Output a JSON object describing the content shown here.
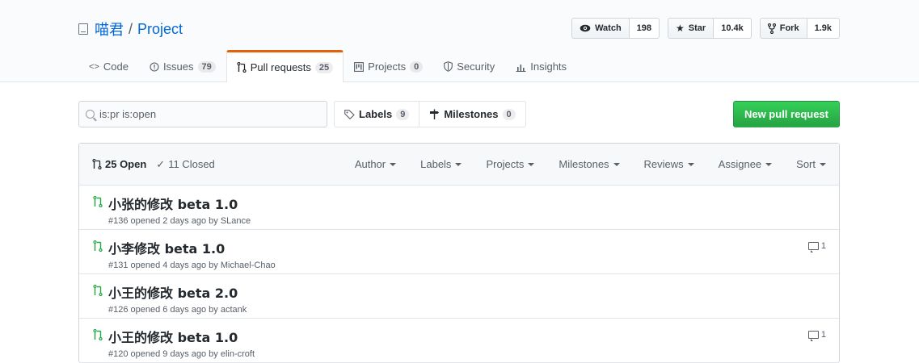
{
  "repo": {
    "owner": "喵君",
    "separator": "/",
    "name": "Project"
  },
  "actions": {
    "watch": {
      "label": "Watch",
      "count": "198"
    },
    "star": {
      "label": "Star",
      "count": "10.4k"
    },
    "fork": {
      "label": "Fork",
      "count": "1.9k"
    }
  },
  "tabs": [
    {
      "label": "Code",
      "counter": ""
    },
    {
      "label": "Issues",
      "counter": "79"
    },
    {
      "label": "Pull requests",
      "counter": "25"
    },
    {
      "label": "Projects",
      "counter": "0"
    },
    {
      "label": "Security",
      "counter": ""
    },
    {
      "label": "Insights",
      "counter": ""
    }
  ],
  "search": {
    "value": "is:pr is:open"
  },
  "subnav": {
    "labels": {
      "label": "Labels",
      "counter": "9"
    },
    "milestones": {
      "label": "Milestones",
      "counter": "0"
    }
  },
  "new_pr_label": "New pull request",
  "states": {
    "open": "25 Open",
    "closed": "11 Closed"
  },
  "filters": [
    "Author",
    "Labels",
    "Projects",
    "Milestones",
    "Reviews",
    "Assignee",
    "Sort"
  ],
  "pulls": [
    {
      "title": "小张的修改 beta 1.0",
      "meta": "#136 opened 2 days ago by SLance",
      "comments": ""
    },
    {
      "title": "小李修改 beta 1.0",
      "meta": "#131 opened 4 days ago by Michael-Chao",
      "comments": "1"
    },
    {
      "title": "小王的修改 beta 2.0",
      "meta": "#126 opened 6 days ago by actank",
      "comments": ""
    },
    {
      "title": "小王的修改 beta 1.0",
      "meta": "#120 opened 9 days ago by elin-croft",
      "comments": "1"
    }
  ],
  "colors": {
    "accent": "#0366d6",
    "green": "#28a745",
    "tab_selected": "#e36209"
  }
}
